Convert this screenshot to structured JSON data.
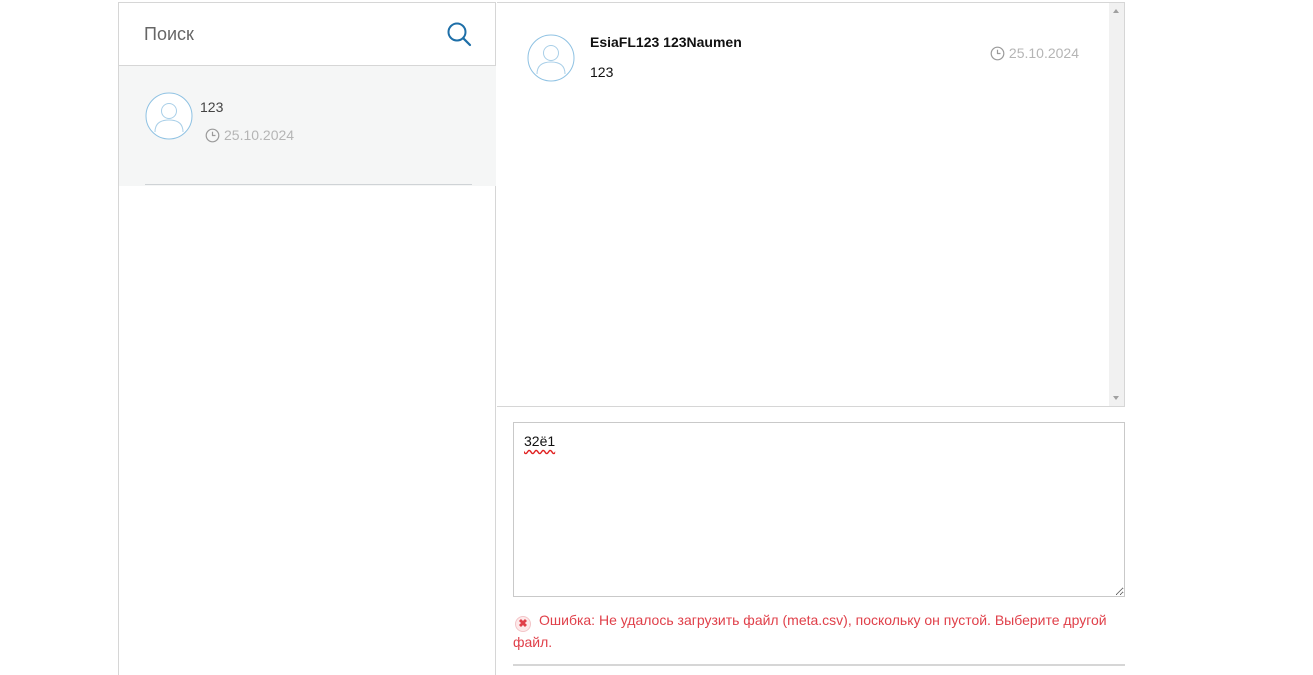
{
  "search": {
    "placeholder": "Поиск"
  },
  "dialogs": [
    {
      "name": "123",
      "date": "25.10.2024"
    }
  ],
  "messages": [
    {
      "author": "EsiaFL123 123Naumen",
      "text": "123",
      "date": "25.10.2024"
    }
  ],
  "compose": {
    "value": "32ё1"
  },
  "error": {
    "text": "Ошибка: Не удалось загрузить файл (meta.csv), поскольку он пустой. Выберите другой файл."
  },
  "colors": {
    "accent": "#1e6fa8",
    "error": "#e0404a",
    "date": "#b5b5b5",
    "selected_bg": "#f5f6f6"
  },
  "icons": [
    "search-icon",
    "avatar-icon",
    "clock-icon",
    "error-icon"
  ]
}
